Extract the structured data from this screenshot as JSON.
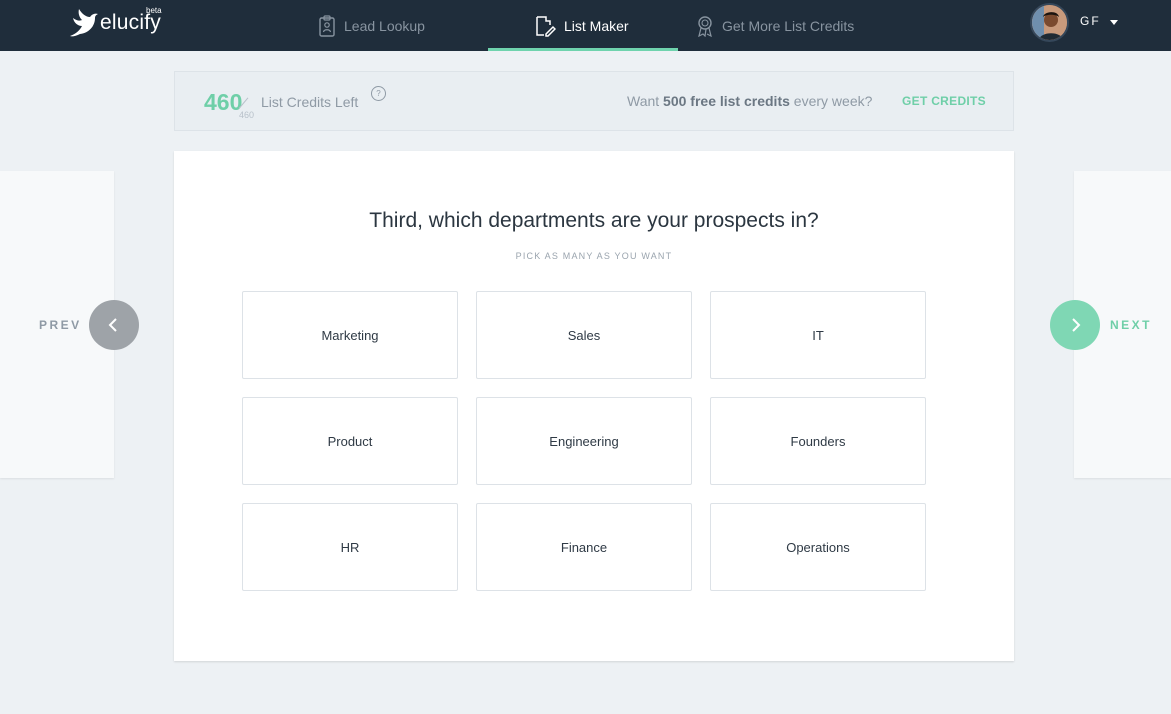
{
  "brand": {
    "name": "elucify",
    "badge": "beta"
  },
  "nav": {
    "items": [
      {
        "label": "Lead Lookup",
        "icon": "badge-icon"
      },
      {
        "label": "List Maker",
        "icon": "list-edit-icon",
        "active": true
      },
      {
        "label": "Get More List Credits",
        "icon": "award-ribbon-icon"
      }
    ],
    "active_underline_color": "#6fd3ad"
  },
  "user": {
    "initials": "GF",
    "avatar_icon": "user-avatar"
  },
  "credits": {
    "remaining": "460",
    "total": "460",
    "label": "List Credits Left",
    "help": "?",
    "promo_prefix": "Want ",
    "promo_bold": "500 free list credits",
    "promo_suffix": " every week?",
    "cta": "GET CREDITS"
  },
  "step": {
    "question": "Third, which departments are your prospects in?",
    "hint": "PICK AS MANY AS YOU WANT",
    "options": [
      "Marketing",
      "Sales",
      "IT",
      "Product",
      "Engineering",
      "Founders",
      "HR",
      "Finance",
      "Operations"
    ]
  },
  "pager": {
    "prev": "PREV",
    "next": "NEXT"
  },
  "colors": {
    "accent": "#6fcfa8",
    "topbar": "#1f2d3b",
    "background": "#edf1f4"
  }
}
